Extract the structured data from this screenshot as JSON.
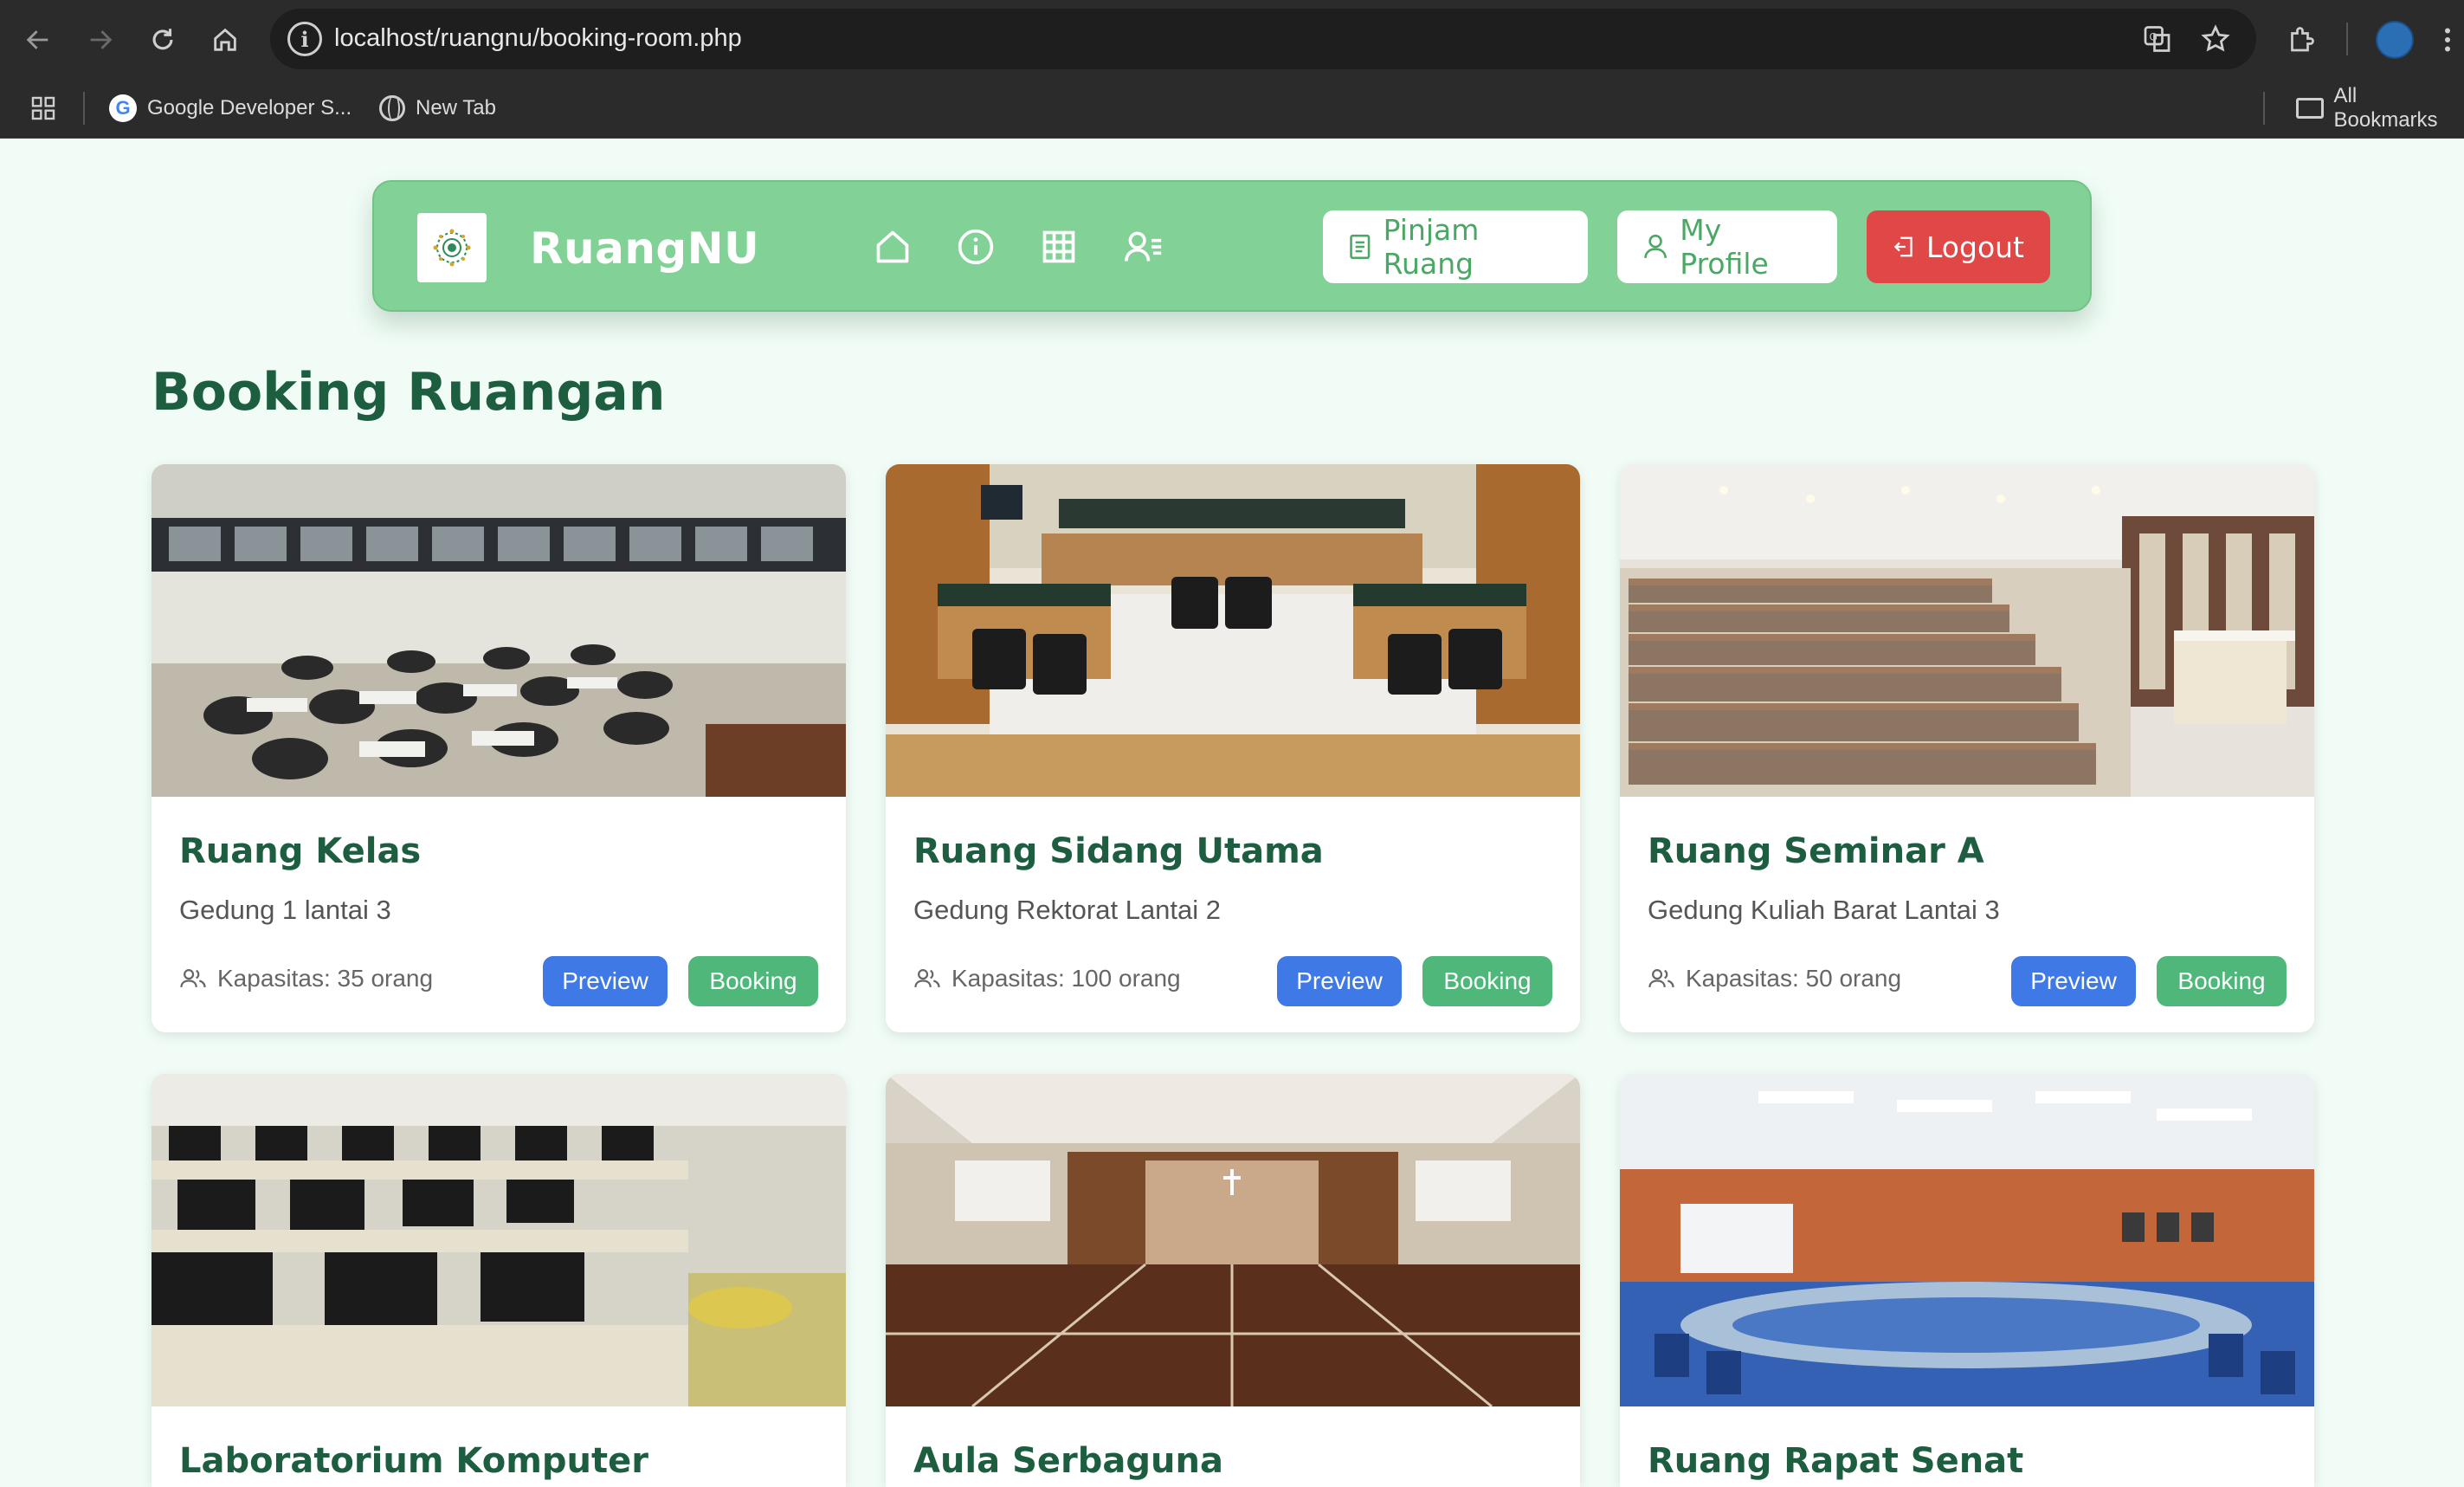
{
  "browser": {
    "url": "localhost/ruangnu/booking-room.php",
    "bookmarks": [
      "Google Developer S...",
      "New Tab"
    ],
    "all_bookmarks": "All Bookmarks"
  },
  "header": {
    "brand": "RuangNU",
    "nav_icons": [
      "home-icon",
      "info-icon",
      "grid-icon",
      "user-list-icon"
    ],
    "buttons": {
      "pinjam": "Pinjam Ruang",
      "profile": "My Profile",
      "logout": "Logout"
    },
    "colors": {
      "bar": "#82d196",
      "logout": "#e04848",
      "accent_text": "#4aa864"
    }
  },
  "main": {
    "title": "Booking Ruangan",
    "preview_label": "Preview",
    "booking_label": "Booking",
    "rooms": [
      {
        "name": "Ruang Kelas",
        "location": "Gedung 1 lantai 3",
        "capacity": "Kapasitas: 35 orang"
      },
      {
        "name": "Ruang Sidang Utama",
        "location": "Gedung Rektorat Lantai 2",
        "capacity": "Kapasitas: 100 orang"
      },
      {
        "name": "Ruang Seminar A",
        "location": "Gedung Kuliah Barat Lantai 3",
        "capacity": "Kapasitas: 50 orang"
      },
      {
        "name": "Laboratorium Komputer"
      },
      {
        "name": "Aula Serbaguna"
      },
      {
        "name": "Ruang Rapat Senat"
      }
    ],
    "colors": {
      "title": "#1e5e40",
      "preview": "#3f79e6",
      "booking": "#4fb77a"
    }
  }
}
